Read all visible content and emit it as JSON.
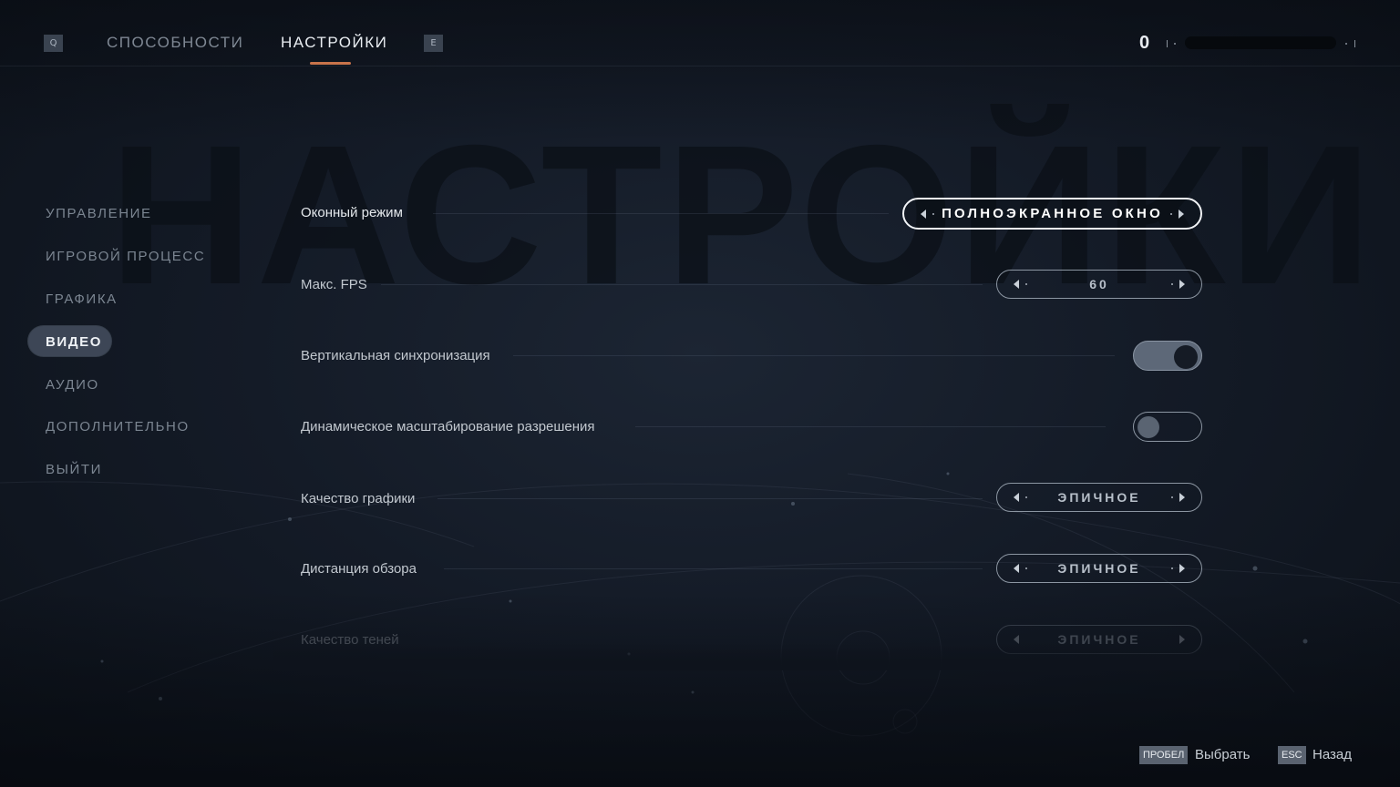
{
  "background_title": "НАСТРОЙКИ",
  "topbar": {
    "left_key": "Q",
    "right_key": "E",
    "tabs": [
      {
        "label": "СПОСОБНОСТИ",
        "active": false
      },
      {
        "label": "НАСТРОЙКИ",
        "active": true
      }
    ],
    "counter": "0",
    "accent_color": "#c9734a"
  },
  "sidebar": {
    "items": [
      {
        "label": "УПРАВЛЕНИЕ",
        "active": false
      },
      {
        "label": "ИГРОВОЙ ПРОЦЕСС",
        "active": false
      },
      {
        "label": "ГРАФИКА",
        "active": false
      },
      {
        "label": "ВИДЕО",
        "active": true
      },
      {
        "label": "АУДИО",
        "active": false
      },
      {
        "label": "ДОПОЛНИТЕЛЬНО",
        "active": false
      },
      {
        "label": "ВЫЙТИ",
        "active": false
      }
    ]
  },
  "settings": {
    "window_mode": {
      "label": "Оконный режим",
      "value": "ПОЛНОЭКРАННОЕ ОКНО",
      "focused": true
    },
    "max_fps": {
      "label": "Макс. FPS",
      "value": "60"
    },
    "vsync": {
      "label": "Вертикальная синхронизация",
      "on": true
    },
    "dynamic_resolution": {
      "label": "Динамическое масштабирование разрешения",
      "on": false
    },
    "graphics_quality": {
      "label": "Качество графики",
      "value": "ЭПИЧНОЕ"
    },
    "view_distance": {
      "label": "Дистанция обзора",
      "value": "ЭПИЧНОЕ"
    },
    "shadow_quality": {
      "label": "Качество теней",
      "value": "ЭПИЧНОЕ"
    }
  },
  "footer": {
    "select_key": "ПРОБЕЛ",
    "select_label": "Выбрать",
    "back_key": "ESC",
    "back_label": "Назад"
  }
}
